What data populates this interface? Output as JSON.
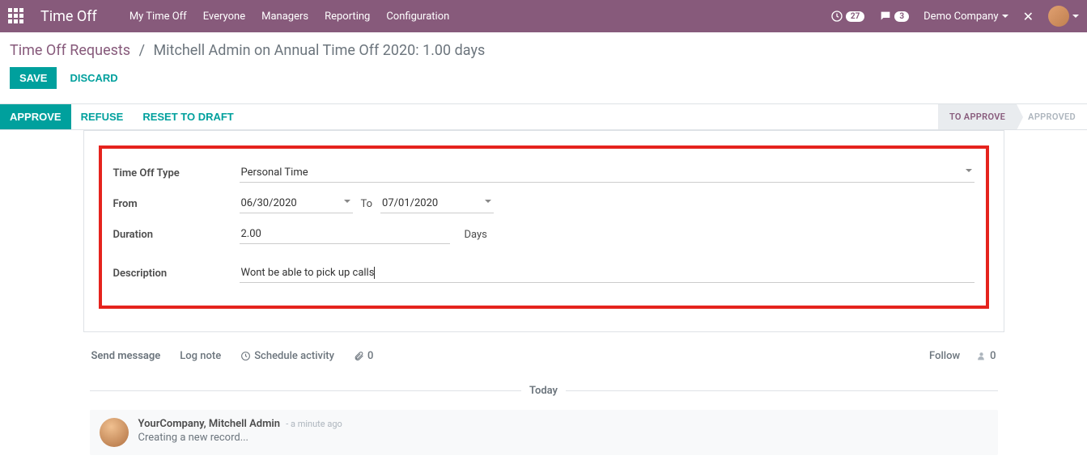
{
  "topbar": {
    "app_title": "Time Off",
    "nav": [
      "My Time Off",
      "Everyone",
      "Managers",
      "Reporting",
      "Configuration"
    ],
    "clock_badge": "27",
    "chat_badge": "3",
    "company": "Demo Company"
  },
  "breadcrumb": {
    "root": "Time Off Requests",
    "current": "Mitchell Admin on Annual Time Off 2020: 1.00 days"
  },
  "actions": {
    "save": "Save",
    "discard": "Discard"
  },
  "statusbar": {
    "approve": "Approve",
    "refuse": "Refuse",
    "reset": "Reset to Draft",
    "to_approve": "To Approve",
    "approved": "Approved"
  },
  "form": {
    "type_label": "Time Off Type",
    "type_value": "Personal Time",
    "from_label": "From",
    "from_value": "06/30/2020",
    "to_label": "To",
    "to_value": "07/01/2020",
    "duration_label": "Duration",
    "duration_value": "2.00",
    "days_label": "Days",
    "desc_label": "Description",
    "desc_value": "Wont be able to pick up calls"
  },
  "chatter": {
    "send": "Send message",
    "log": "Log note",
    "schedule": "Schedule activity",
    "attach_count": "0",
    "follow": "Follow",
    "followers": "0",
    "today": "Today",
    "msg_author": "YourCompany, Mitchell Admin",
    "msg_time": "- a minute ago",
    "msg_body": "Creating a new record..."
  }
}
